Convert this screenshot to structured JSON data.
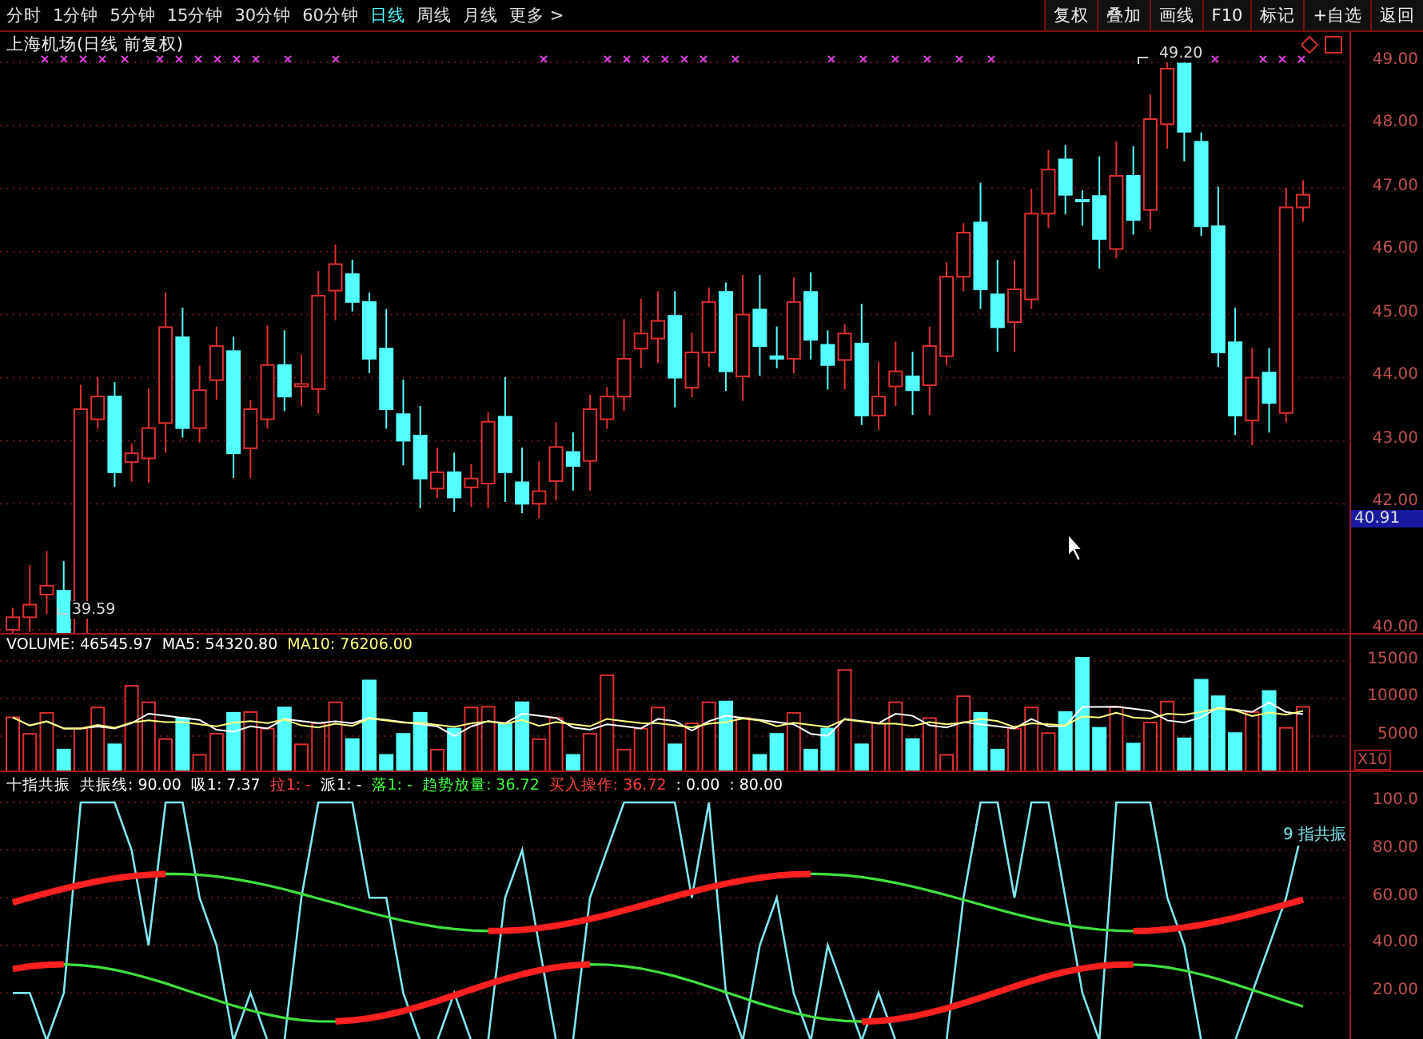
{
  "toolbar": {
    "periods": [
      {
        "label": "分时",
        "selected": false
      },
      {
        "label": "1分钟",
        "selected": false
      },
      {
        "label": "5分钟",
        "selected": false
      },
      {
        "label": "15分钟",
        "selected": false
      },
      {
        "label": "30分钟",
        "selected": false
      },
      {
        "label": "60分钟",
        "selected": false
      },
      {
        "label": "日线",
        "selected": true
      },
      {
        "label": "周线",
        "selected": false
      },
      {
        "label": "月线",
        "selected": false
      },
      {
        "label": "更多 >",
        "selected": false
      }
    ],
    "actions": [
      "复权",
      "叠加",
      "画线",
      "F10",
      "标记",
      "+自选",
      "返回"
    ]
  },
  "price_panel": {
    "title": "上海机场(日线 前复权)",
    "high_label": "49.20",
    "low_label": "39.59",
    "axis": [
      "49.00",
      "48.00",
      "47.00",
      "46.00",
      "45.00",
      "44.00",
      "43.00",
      "42.00",
      "40.00"
    ],
    "current_price": "40.91"
  },
  "volume_panel": {
    "legend": [
      {
        "text": "VOLUME: 46545.97",
        "color": "#ffffff"
      },
      {
        "text": "MA5: 54320.80",
        "color": "#ffffff"
      },
      {
        "text": "MA10: 76206.00",
        "color": "#ffff80"
      }
    ],
    "axis": [
      "15000",
      "10000",
      "5000"
    ],
    "unit": "X10"
  },
  "indicator_panel": {
    "legend": [
      {
        "text": "十指共振",
        "color": "#ffffff"
      },
      {
        "text": "共振线: 90.00",
        "color": "#ffffff"
      },
      {
        "text": "吸1: 7.37",
        "color": "#ffffff"
      },
      {
        "text": "拉1: -",
        "color": "#ff4040"
      },
      {
        "text": "派1: -",
        "color": "#ffffff"
      },
      {
        "text": "落1: -",
        "color": "#40ff40"
      },
      {
        "text": "趋势放量: 36.72",
        "color": "#40ff40"
      },
      {
        "text": "买入操作: 36.72",
        "color": "#ff4040"
      },
      {
        "text": ": 0.00",
        "color": "#ffffff"
      },
      {
        "text": ": 80.00",
        "color": "#ffffff"
      }
    ],
    "axis": [
      "100.0",
      "80.00",
      "60.00",
      "40.00",
      "20.00"
    ],
    "line_label": "9 指共振"
  }
}
